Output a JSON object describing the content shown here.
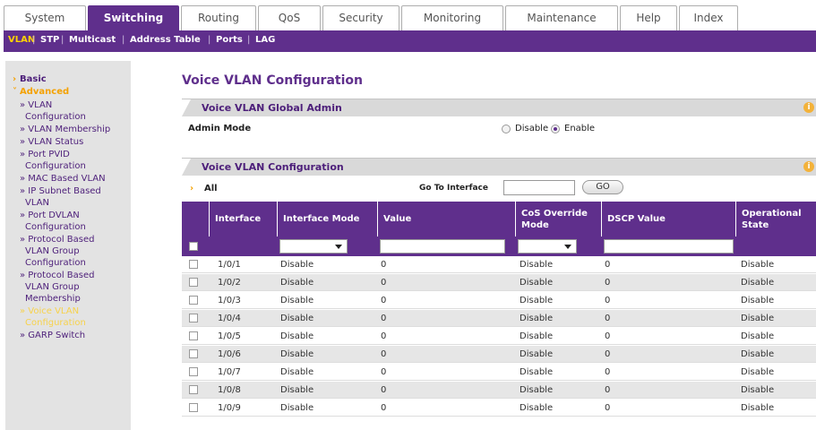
{
  "top_tabs": [
    {
      "label": "System",
      "active": false
    },
    {
      "label": "Switching",
      "active": true
    },
    {
      "label": "Routing",
      "active": false
    },
    {
      "label": "QoS",
      "active": false
    },
    {
      "label": "Security",
      "active": false
    },
    {
      "label": "Monitoring",
      "active": false
    },
    {
      "label": "Maintenance",
      "active": false
    },
    {
      "label": "Help",
      "active": false
    },
    {
      "label": "Index",
      "active": false
    }
  ],
  "sub_nav": [
    {
      "label": "VLAN",
      "active": true
    },
    {
      "label": "STP",
      "active": false
    },
    {
      "label": "Multicast",
      "active": false
    },
    {
      "label": "Address Table",
      "active": false
    },
    {
      "label": "Ports",
      "active": false
    },
    {
      "label": "LAG",
      "active": false
    }
  ],
  "sidebar": {
    "basic": "Basic",
    "advanced": "Advanced",
    "lines": [
      "» VLAN",
      "Configuration",
      "» VLAN Membership",
      "» VLAN Status",
      "» Port PVID",
      "Configuration",
      "» MAC Based VLAN",
      "» IP Subnet Based",
      "VLAN",
      "» Port DVLAN",
      "Configuration",
      "» Protocol Based",
      "VLAN Group",
      "Configuration",
      "» Protocol Based",
      "VLAN Group",
      "Membership",
      "» Voice VLAN",
      "Configuration",
      "» GARP Switch"
    ]
  },
  "page_title": "Voice VLAN Configuration",
  "global_admin": {
    "section_title": "Voice VLAN Global Admin",
    "admin_mode_label": "Admin Mode",
    "disable_label": "Disable",
    "enable_label": "Enable",
    "selected": "Enable"
  },
  "config": {
    "section_title": "Voice VLAN Configuration",
    "all_label": "All",
    "go_to_label": "Go To Interface",
    "go_value": "",
    "go_button": "GO"
  },
  "table": {
    "headers": [
      "Interface",
      "Interface Mode",
      "Value",
      "CoS Override Mode",
      "DSCP Value",
      "Operational State"
    ],
    "rows": [
      [
        "1/0/1",
        "Disable",
        "0",
        "Disable",
        "0",
        "Disable"
      ],
      [
        "1/0/2",
        "Disable",
        "0",
        "Disable",
        "0",
        "Disable"
      ],
      [
        "1/0/3",
        "Disable",
        "0",
        "Disable",
        "0",
        "Disable"
      ],
      [
        "1/0/4",
        "Disable",
        "0",
        "Disable",
        "0",
        "Disable"
      ],
      [
        "1/0/5",
        "Disable",
        "0",
        "Disable",
        "0",
        "Disable"
      ],
      [
        "1/0/6",
        "Disable",
        "0",
        "Disable",
        "0",
        "Disable"
      ],
      [
        "1/0/7",
        "Disable",
        "0",
        "Disable",
        "0",
        "Disable"
      ],
      [
        "1/0/8",
        "Disable",
        "0",
        "Disable",
        "0",
        "Disable"
      ],
      [
        "1/0/9",
        "Disable",
        "0",
        "Disable",
        "0",
        "Disable"
      ]
    ]
  },
  "colors": {
    "accent": "#5f2f8c",
    "sidebar_bg": "#e3e3e3",
    "active_orange": "#f4a100",
    "row_alt": "#e6e6e6"
  }
}
